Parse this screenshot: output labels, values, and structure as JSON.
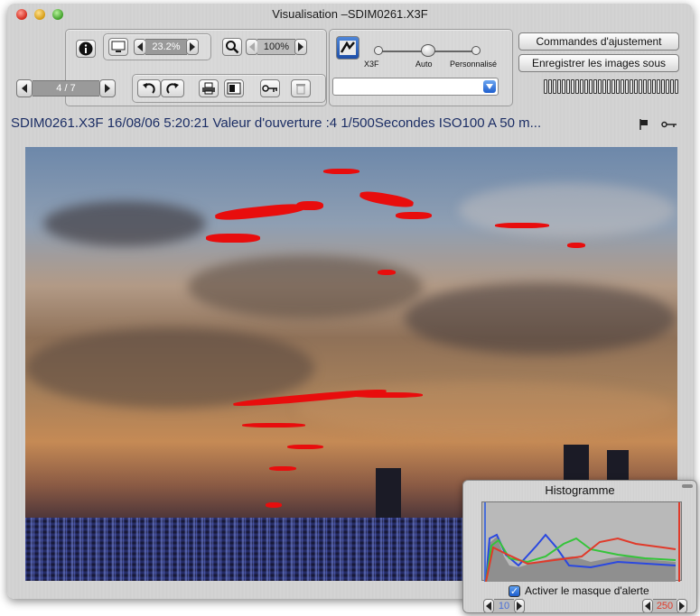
{
  "window": {
    "title": "Visualisation –SDIM0261.X3F"
  },
  "toolbar": {
    "info_icon": "info-icon",
    "zoom_fit_value": "23.2%",
    "zoom_value": "100%",
    "page_counter": "4 / 7",
    "slider": {
      "labels": [
        "X3F",
        "Auto",
        "Personnalisé"
      ],
      "selected": "Auto"
    },
    "adjust_button": "Commandes d'ajustement",
    "save_button": "Enregistrer les images sous",
    "preset_value": ""
  },
  "info_bar": {
    "text": "SDIM0261.X3F 16/08/06 5:20:21 Valeur d'ouverture :4 1/500Secondes ISO100 A 50 m...",
    "flag_icon": "flag-icon",
    "key_icon": "key-icon"
  },
  "histogram": {
    "title": "Histogramme",
    "alert_label": "Activer le masque d'alerte",
    "alert_checked": true,
    "low_value": "10",
    "high_value": "250",
    "colors": {
      "red": "#e03a2a",
      "green": "#35c43a",
      "blue": "#2a48e0",
      "low": "#4a6fd8",
      "high": "#e03a2a"
    }
  }
}
